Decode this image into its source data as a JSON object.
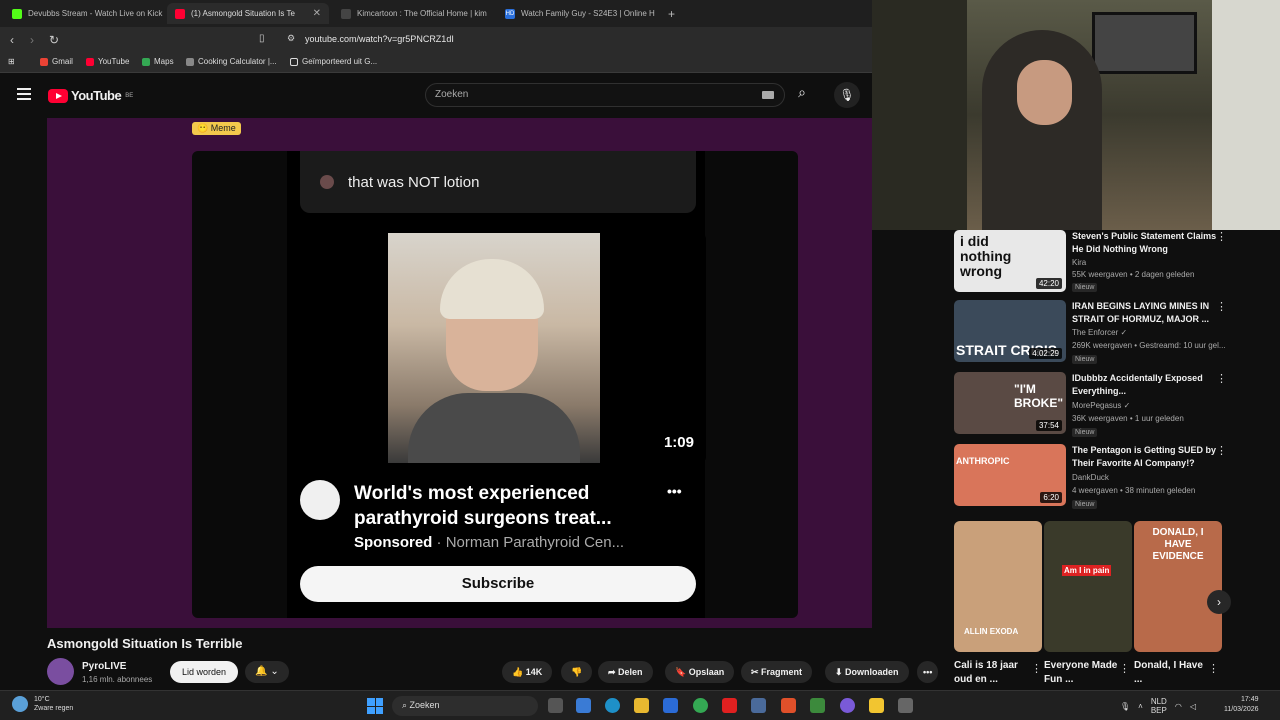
{
  "browser": {
    "tabs": [
      {
        "title": "Devubbs Stream - Watch Live on Kick",
        "color": "#53fc18"
      },
      {
        "title": "(1) Asmongold Situation Is Te",
        "color": "#ff0033"
      },
      {
        "title": "Kimcartoon : The Official Home | kim",
        "color": "#444444"
      },
      {
        "title": "Watch Family Guy - S24E3 | Online H",
        "color": "#2a6fdb"
      }
    ],
    "tab_hd_label": "HD",
    "new_tab": "+",
    "url": "youtube.com/watch?v=gr5PNCRZ1dI",
    "bookmarks": [
      "Gmail",
      "YouTube",
      "Maps",
      "Cooking Calculator |...",
      "Geïmporteerd uit G..."
    ]
  },
  "youtube": {
    "logo_text": "YouTube",
    "region": "BE",
    "search_placeholder": "Zoeken"
  },
  "video": {
    "meme_badge": "😶 Meme",
    "comment_text": "that was NOT lotion",
    "inner_duration": "1:09",
    "ad_title": "World's most experienced parathyroid surgeons treat...",
    "ad_more": "•••",
    "ad_sponsored": "Sponsored",
    "ad_separator": "·",
    "ad_advertiser": "Norman Parathyroid Cen...",
    "subscribe_label": "Subscribe",
    "title": "Asmongold Situation Is Terrible",
    "channel_name": "PyroLIVE",
    "channel_subs": "1,16 mln. abonnees",
    "join_label": "Lid worden",
    "bell_label": "🔔 ⌄",
    "like_label": "👍  14K",
    "dislike_label": "👎",
    "share_label": "➦  Delen",
    "save_label": "🔖  Opslaan",
    "clip_label": "✂  Fragment",
    "download_label": "⬇  Downloaden",
    "more_label": "•••"
  },
  "recommendations": [
    {
      "title": "Steven's Public Statement Claims He Did Nothing Wrong",
      "channel": "Kira",
      "meta": "55K weergaven • 2 dagen geleden",
      "badge": "Nieuw",
      "duration": "42:20",
      "thumb_text": "i did nothing wrong",
      "thumb_color": "#e8e8e8"
    },
    {
      "title": "IRAN BEGINS LAYING MINES IN STRAIT OF HORMUZ, MAJOR ...",
      "channel": "The Enforcer ✓",
      "meta": "269K weergaven • Gestreamd: 10 uur gel...",
      "badge": "Nieuw",
      "duration": "4:02:29",
      "thumb_text": "STRAIT CRISIS",
      "thumb_color": "#3b4a5a"
    },
    {
      "title": "IDubbbz Accidentally Exposed Everything...",
      "channel": "MorePegasus ✓",
      "meta": "36K weergaven • 1 uur geleden",
      "badge": "Nieuw",
      "duration": "37:54",
      "thumb_text": "\"I'M BROKE\"",
      "thumb_color": "#5a4a44"
    },
    {
      "title": "The Pentagon is Getting SUED by Their Favorite AI Company!?",
      "channel": "DankDuck",
      "meta": "4 weergaven • 38 minuten geleden",
      "badge": "Nieuw",
      "duration": "6:20",
      "thumb_text": "ANTHROPIC",
      "thumb_color": "#d9755a"
    }
  ],
  "shorts": [
    {
      "title": "Cali is 18 jaar oud en ...",
      "thumb_text": "ALLIN EXODA",
      "color": "#c9a07a"
    },
    {
      "title": "Everyone Made Fun ...",
      "thumb_text": "Am I in pain",
      "color": "#3a3a2a"
    },
    {
      "title": "Donald, I Have ...",
      "thumb_text": "DONALD, I HAVE EVIDENCE",
      "color": "#b86a4a"
    }
  ],
  "taskbar": {
    "weather_temp": "10°C",
    "weather_desc": "Zware regen",
    "search_label": "Zoeken",
    "lang_1": "NLD",
    "lang_2": "BEP",
    "time": "17:49",
    "date": "11/03/2026"
  }
}
